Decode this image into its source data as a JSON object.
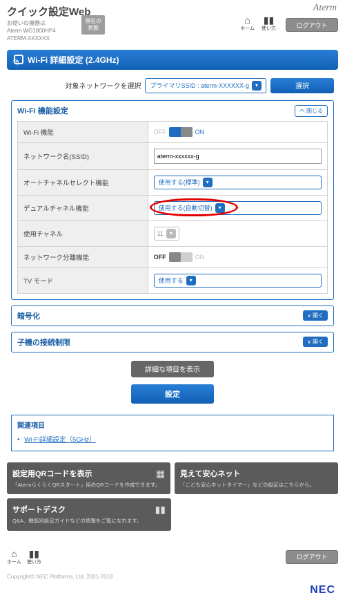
{
  "header": {
    "title": "クイック設定Web",
    "device_line1": "お使いの機器は",
    "device_line2": "Aterm WG1800HP4",
    "device_line3": "ATERM-XXXXXX",
    "status_btn": "現在の状態",
    "brand": "Aterm",
    "home": "ホーム",
    "help": "使い方",
    "logout": "ログアウト"
  },
  "page_bar": "Wi-Fi 詳細設定 (2.4GHz)",
  "target": {
    "label": "対象ネットワークを選択",
    "selected": "プライマリSSID : aterm-XXXXXX-g",
    "select_btn": "選択"
  },
  "card1": {
    "title": "Wi-Fi 機能設定",
    "collapse": "閉じる"
  },
  "rows": {
    "r1k": "Wi-Fi 機能",
    "r2k": "ネットワーク名(SSID)",
    "r2v": "aterm-xxxxxx-g",
    "r3k": "オートチャネルセレクト機能",
    "r3v": "使用する(標準)",
    "r4k": "デュアルチャネル機能",
    "r4v": "使用する(自動切替)",
    "r5k": "使用チャネル",
    "r5v": "11",
    "r6k": "ネットワーク分離機能",
    "r7k": "TV モード",
    "r7v": "使用する",
    "off": "OFF",
    "on": "ON"
  },
  "card2": {
    "title": "暗号化",
    "expand": "開く"
  },
  "card3": {
    "title": "子機の接続制限",
    "expand": "開く"
  },
  "buttons": {
    "detail": "詳細な項目を表示",
    "apply": "設定"
  },
  "related": {
    "heading": "関連項目",
    "link": "Wi-Fi詳細設定（5GHz）"
  },
  "tiles": {
    "qr_t": "設定用QRコードを表示",
    "qr_d": "「AtermらくらくQRスタート」用のQRコードを作成できます。",
    "safe_t": "見えて安心ネット",
    "safe_d": "「こども安心ネットタイマー」などの設定はこちらから。",
    "sup_t": "サポートデスク",
    "sup_d": "Q&A、機能別設定ガイドなどの情報をご覧になれます。"
  },
  "footer": {
    "home": "ホーム",
    "help": "使い方",
    "logout": "ログアウト",
    "copyright": "Copyright© NEC Platforms, Ltd. 2001-2018",
    "nec": "NEC"
  }
}
